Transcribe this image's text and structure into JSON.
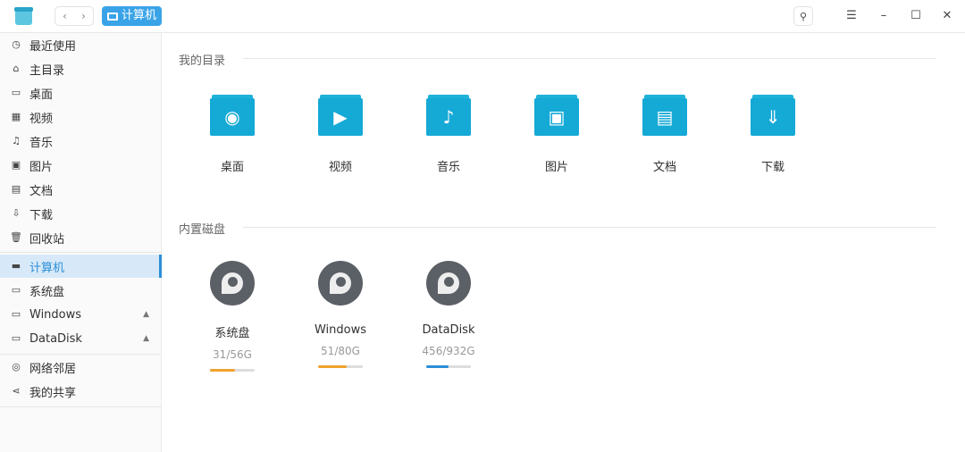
{
  "titlebar": {
    "nav_back": "‹",
    "nav_forward": "›",
    "breadcrumb": "计算机",
    "search_icon": "⚲",
    "menu_icon": "☰",
    "minimize": "–",
    "maximize": "☐",
    "close": "✕"
  },
  "sidebar": {
    "items": [
      {
        "label": "最近使用",
        "icon": "clock-icon",
        "glyph": "◷"
      },
      {
        "label": "主目录",
        "icon": "home-icon",
        "glyph": "⌂"
      },
      {
        "label": "桌面",
        "icon": "desktop-icon",
        "glyph": "▭"
      },
      {
        "label": "视频",
        "icon": "video-icon",
        "glyph": "▦"
      },
      {
        "label": "音乐",
        "icon": "music-icon",
        "glyph": "♫"
      },
      {
        "label": "图片",
        "icon": "picture-icon",
        "glyph": "▣"
      },
      {
        "label": "文档",
        "icon": "document-icon",
        "glyph": "▤"
      },
      {
        "label": "下载",
        "icon": "download-icon",
        "glyph": "⇩"
      },
      {
        "label": "回收站",
        "icon": "trash-icon",
        "glyph": "🗑"
      },
      {
        "label": "计算机",
        "icon": "computer-icon",
        "glyph": "▬"
      },
      {
        "label": "系统盘",
        "icon": "disk-icon",
        "glyph": "▭"
      },
      {
        "label": "Windows",
        "icon": "disk-icon",
        "glyph": "▭",
        "eject": "▲"
      },
      {
        "label": "DataDisk",
        "icon": "disk-icon",
        "glyph": "▭",
        "eject": "▲"
      },
      {
        "label": "网络邻居",
        "icon": "network-icon",
        "glyph": "◎"
      },
      {
        "label": "我的共享",
        "icon": "share-icon",
        "glyph": "⋖"
      }
    ]
  },
  "main": {
    "dirs_title": "我的目录",
    "dirs": [
      {
        "label": "桌面",
        "glyph": "◉"
      },
      {
        "label": "视频",
        "glyph": "▶"
      },
      {
        "label": "音乐",
        "glyph": "♪"
      },
      {
        "label": "图片",
        "glyph": "▣"
      },
      {
        "label": "文档",
        "glyph": "▤"
      },
      {
        "label": "下载",
        "glyph": "⇓"
      }
    ],
    "disks_title": "内置磁盘",
    "disks": [
      {
        "label": "系统盘",
        "usage": "31/56G",
        "fraction": 0.55,
        "color": "#f0a22e"
      },
      {
        "label": "Windows",
        "usage": "51/80G",
        "fraction": 0.64,
        "color": "#f0a22e"
      },
      {
        "label": "DataDisk",
        "usage": "456/932G",
        "fraction": 0.49,
        "color": "#2c8fd6"
      }
    ]
  }
}
